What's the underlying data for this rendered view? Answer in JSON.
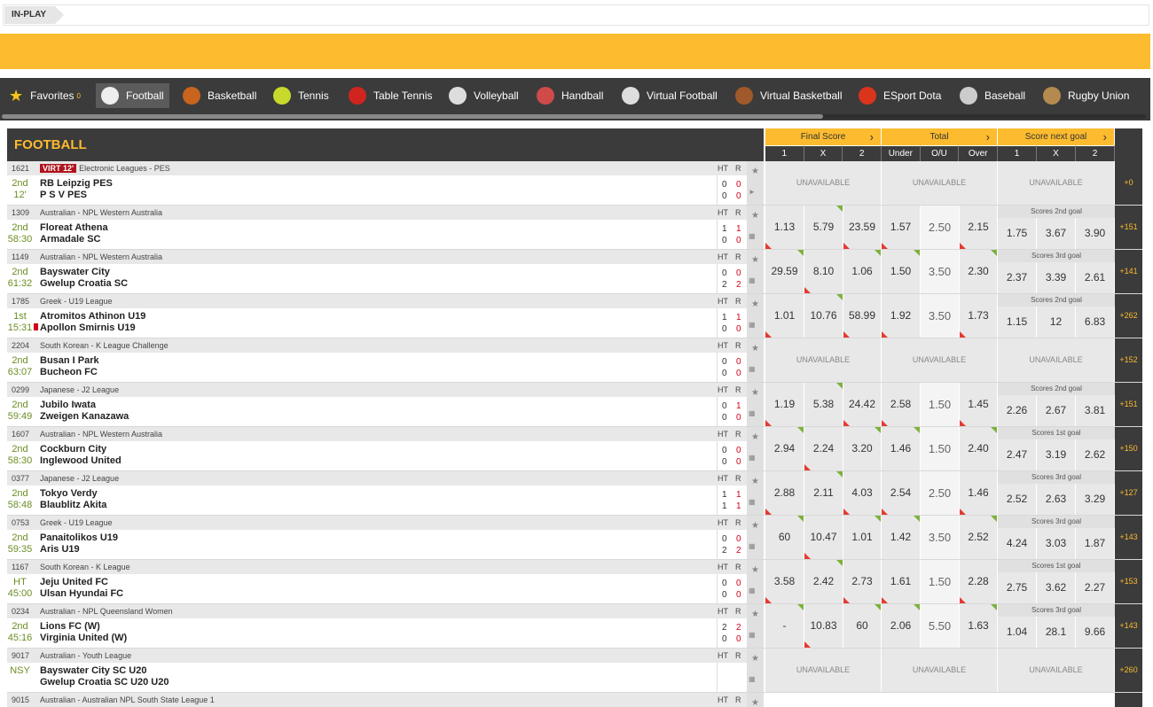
{
  "breadcrumb": "IN-PLAY",
  "sports": [
    {
      "label": "Favorites",
      "count": "0",
      "icon": "star-icon",
      "color": "#f5c518"
    },
    {
      "label": "Football",
      "icon": "football-icon",
      "color": "#eeeeee"
    },
    {
      "label": "Basketball",
      "icon": "basketball-icon",
      "color": "#c8641e"
    },
    {
      "label": "Tennis",
      "icon": "tennis-ball-icon",
      "color": "#c7d92b"
    },
    {
      "label": "Table Tennis",
      "icon": "table-tennis-icon",
      "color": "#d0241f"
    },
    {
      "label": "Volleyball",
      "icon": "volleyball-icon",
      "color": "#dddddd"
    },
    {
      "label": "Handball",
      "icon": "handball-icon",
      "color": "#d04a4a"
    },
    {
      "label": "Virtual Football",
      "icon": "virtual-football-icon",
      "color": "#dddddd"
    },
    {
      "label": "Virtual Basketball",
      "icon": "virtual-basketball-icon",
      "color": "#a0592a"
    },
    {
      "label": "ESport Dota",
      "icon": "dota-icon",
      "color": "#d9341c"
    },
    {
      "label": "Baseball",
      "icon": "baseball-icon",
      "color": "#cccccc"
    },
    {
      "label": "Rugby Union",
      "icon": "rugby-icon",
      "color": "#b58a50"
    }
  ],
  "section_title": "FOOTBALL",
  "markets": [
    {
      "title": "Final Score",
      "cols": [
        "1",
        "X",
        "2"
      ]
    },
    {
      "title": "Total",
      "cols": [
        "Under",
        "O/U",
        "Over"
      ]
    },
    {
      "title": "Score next goal",
      "cols": [
        "1",
        "X",
        "2"
      ]
    }
  ],
  "labels": {
    "ht": "HT",
    "r": "R",
    "unavailable": "UNAVAILABLE",
    "virt": "VIRT 12'"
  },
  "matches": [
    {
      "id": "1621",
      "league": "Electronic Leagues - PES",
      "virt": true,
      "period": "2nd",
      "time": "12'",
      "home": "RB Leipzig PES",
      "away": "P S V PES",
      "ht": [
        "0",
        "0"
      ],
      "r": [
        "0",
        "0"
      ],
      "red": false,
      "ft": null,
      "total": null,
      "ng": null,
      "more": "+0"
    },
    {
      "id": "1309",
      "league": "Australian - NPL Western Australia",
      "period": "2nd",
      "time": "58:30",
      "home": "Floreat Athena",
      "away": "Armadale SC",
      "ht": [
        "1",
        "0"
      ],
      "r": [
        "1",
        "0"
      ],
      "ft": [
        "1.13",
        "5.79",
        "23.59"
      ],
      "total": [
        "1.57",
        "2.50",
        "2.15"
      ],
      "ng": {
        "title": "Scores 2nd goal",
        "odds": [
          "1.75",
          "3.67",
          "3.90"
        ]
      },
      "more": "+151"
    },
    {
      "id": "1149",
      "league": "Australian - NPL Western Australia",
      "period": "2nd",
      "time": "61:32",
      "home": "Bayswater City",
      "away": "Gwelup Croatia SC",
      "ht": [
        "0",
        "2"
      ],
      "r": [
        "0",
        "2"
      ],
      "ft": [
        "29.59",
        "8.10",
        "1.06"
      ],
      "total": [
        "1.50",
        "3.50",
        "2.30"
      ],
      "ng": {
        "title": "Scores 3rd goal",
        "odds": [
          "2.37",
          "3.39",
          "2.61"
        ]
      },
      "more": "+141"
    },
    {
      "id": "1785",
      "league": "Greek - U19 League",
      "period": "1st",
      "time": "15:31",
      "home": "Atromitos Athinon U19",
      "away": "Apollon Smirnis U19",
      "red": true,
      "ht": [
        "1",
        "0"
      ],
      "r": [
        "1",
        "0"
      ],
      "ft": [
        "1.01",
        "10.76",
        "58.99"
      ],
      "total": [
        "1.92",
        "3.50",
        "1.73"
      ],
      "ng": {
        "title": "Scores 2nd goal",
        "odds": [
          "1.15",
          "12",
          "6.83"
        ]
      },
      "more": "+262"
    },
    {
      "id": "2204",
      "league": "South Korean - K League Challenge",
      "period": "2nd",
      "time": "63:07",
      "home": "Busan I Park",
      "away": "Bucheon FC",
      "ht": [
        "0",
        "0"
      ],
      "r": [
        "0",
        "0"
      ],
      "ft": null,
      "total": null,
      "ng": null,
      "more": "+152"
    },
    {
      "id": "0299",
      "league": "Japanese - J2 League",
      "period": "2nd",
      "time": "59:49",
      "home": "Jubilo Iwata",
      "away": "Zweigen Kanazawa",
      "ht": [
        "0",
        "0"
      ],
      "r": [
        "1",
        "0"
      ],
      "ft": [
        "1.19",
        "5.38",
        "24.42"
      ],
      "total": [
        "2.58",
        "1.50",
        "1.45"
      ],
      "ng": {
        "title": "Scores 2nd goal",
        "odds": [
          "2.26",
          "2.67",
          "3.81"
        ]
      },
      "more": "+151"
    },
    {
      "id": "1607",
      "league": "Australian - NPL Western Australia",
      "period": "2nd",
      "time": "58:30",
      "home": "Cockburn City",
      "away": "Inglewood United",
      "ht": [
        "0",
        "0"
      ],
      "r": [
        "0",
        "0"
      ],
      "ft": [
        "2.94",
        "2.24",
        "3.20"
      ],
      "total": [
        "1.46",
        "1.50",
        "2.40"
      ],
      "ng": {
        "title": "Scores 1st goal",
        "odds": [
          "2.47",
          "3.19",
          "2.62"
        ]
      },
      "more": "+150"
    },
    {
      "id": "0377",
      "league": "Japanese - J2 League",
      "period": "2nd",
      "time": "58:48",
      "home": "Tokyo Verdy",
      "away": "Blaublitz Akita",
      "ht": [
        "1",
        "1"
      ],
      "r": [
        "1",
        "1"
      ],
      "ft": [
        "2.88",
        "2.11",
        "4.03"
      ],
      "total": [
        "2.54",
        "2.50",
        "1.46"
      ],
      "ng": {
        "title": "Scores 3rd goal",
        "odds": [
          "2.52",
          "2.63",
          "3.29"
        ]
      },
      "more": "+127"
    },
    {
      "id": "0753",
      "league": "Greek - U19 League",
      "period": "2nd",
      "time": "59:35",
      "home": "Panaitolikos U19",
      "away": "Aris U19",
      "ht": [
        "0",
        "2"
      ],
      "r": [
        "0",
        "2"
      ],
      "ft": [
        "60",
        "10.47",
        "1.01"
      ],
      "total": [
        "1.42",
        "3.50",
        "2.52"
      ],
      "ng": {
        "title": "Scores 3rd goal",
        "odds": [
          "4.24",
          "3.03",
          "1.87"
        ]
      },
      "more": "+143"
    },
    {
      "id": "1167",
      "league": "South Korean - K League",
      "period": "HT",
      "time": "45:00",
      "home": "Jeju United FC",
      "away": "Ulsan Hyundai FC",
      "ht": [
        "0",
        "0"
      ],
      "r": [
        "0",
        "0"
      ],
      "ft": [
        "3.58",
        "2.42",
        "2.73"
      ],
      "total": [
        "1.61",
        "1.50",
        "2.28"
      ],
      "ng": {
        "title": "Scores 1st goal",
        "odds": [
          "2.75",
          "3.62",
          "2.27"
        ]
      },
      "more": "+153"
    },
    {
      "id": "0234",
      "league": "Australian - NPL Queensland Women",
      "period": "2nd",
      "time": "45:16",
      "home": "Lions FC (W)",
      "away": "Virginia United (W)",
      "ht": [
        "2",
        "0"
      ],
      "r": [
        "2",
        "0"
      ],
      "ft": [
        "-",
        "10.83",
        "60"
      ],
      "total": [
        "2.06",
        "5.50",
        "1.63"
      ],
      "ng": {
        "title": "Scores 3rd goal",
        "odds": [
          "1.04",
          "28.1",
          "9.66"
        ]
      },
      "more": "+143"
    },
    {
      "id": "9017",
      "league": "Australian - Youth League",
      "period": "NSY",
      "time": "",
      "home": "Bayswater City SC U20",
      "away": "Gwelup Croatia SC U20 U20",
      "ht": [
        "",
        ""
      ],
      "r": [
        "",
        ""
      ],
      "ft": null,
      "total": null,
      "ng": null,
      "more": "+260"
    },
    {
      "id": "9015",
      "league": "Australian - Australian NPL South State League 1",
      "period": "",
      "time": "",
      "home": "",
      "away": "",
      "ht": [
        "",
        ""
      ],
      "r": [
        "",
        ""
      ],
      "ft": null,
      "total": null,
      "ng": null,
      "more": ""
    }
  ]
}
